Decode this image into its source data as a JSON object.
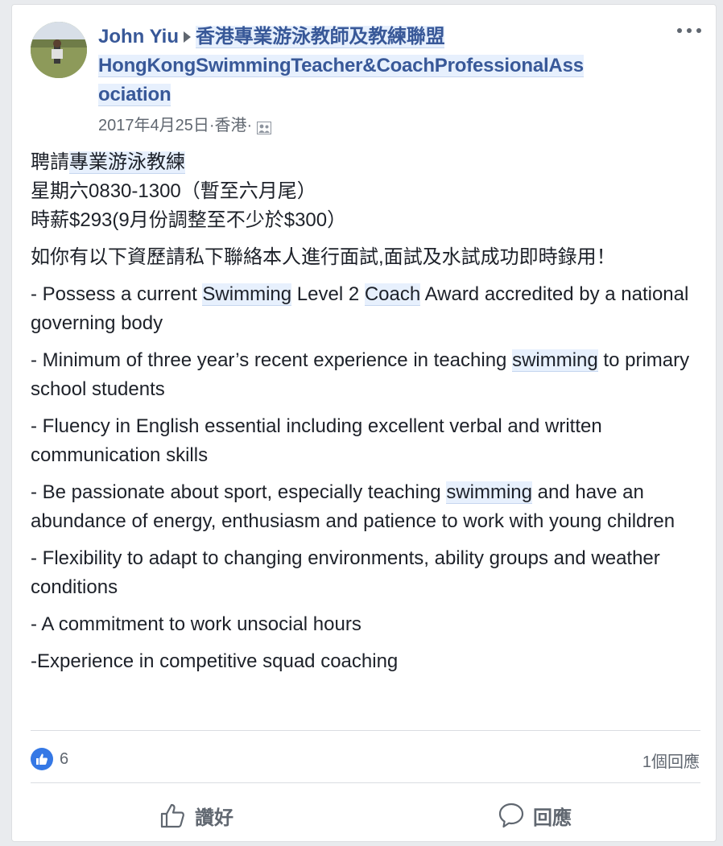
{
  "post": {
    "author": "John Yiu",
    "group_line1": "香港專業游泳教師及教練聯盟",
    "group_line2": "HongKongSwimmingTeacher&CoachProfessionalAss",
    "group_line3": "ociation",
    "date": "2017年4月25日",
    "separator": " · ",
    "location": "香港",
    "lines": {
      "l1_prefix": "聘請",
      "l1_highlight": "專業游泳教練",
      "l2": "星期六0830-1300（暫至六月尾）",
      "l3": "時薪$293(9月份調整至不少於$300）",
      "l4": "如你有以下資歷請私下聯絡本人進行面試,面試及水試成功即時錄用！",
      "b1_a": "- Possess a current ",
      "b1_h1": "Swimming",
      "b1_b": " Level 2 ",
      "b1_h2": "Coach",
      "b1_c": " Award accredited by a national governing body",
      "b2_a": "- Minimum of three year’s recent experience in teaching ",
      "b2_h": "swimming",
      "b2_b": " to primary school students",
      "b3": "- Fluency in English essential including excellent verbal and written communication skills",
      "b4_a": "- Be passionate about sport, especially teaching ",
      "b4_h": "swimming",
      "b4_b": " and have an abundance of energy, enthusiasm and patience to work with young children",
      "b5": "- Flexibility to adapt to changing environments, ability groups and weather conditions",
      "b6": "- A commitment to work unsocial hours",
      "b7": "-Experience in competitive squad coaching"
    }
  },
  "stats": {
    "likes": "6",
    "comments": "1個回應"
  },
  "actions": {
    "like_label": "讚好",
    "comment_label": "回應"
  },
  "colors": {
    "link": "#385898",
    "highlight_bg": "#e7f0fd",
    "like_blue": "#3578e5",
    "muted": "#606770"
  }
}
